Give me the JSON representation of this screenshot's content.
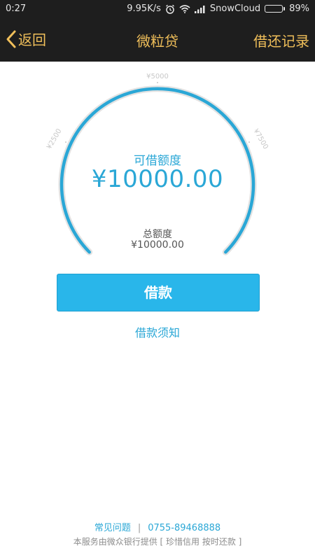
{
  "status_bar": {
    "time": "0:27",
    "speed": "9.95K/s",
    "carrier": "SnowCloud",
    "battery": "89%",
    "battery_level": 0.89,
    "icons": [
      "alarm-icon",
      "wifi-icon",
      "signal-icon",
      "battery-icon"
    ]
  },
  "nav": {
    "back_label": "返回",
    "title": "微粒贷",
    "records_label": "借还记录",
    "accent_color": "#f0bf5a"
  },
  "gauge": {
    "tick_labels": [
      "¥2500",
      "¥5000",
      "¥7500"
    ],
    "available_label": "可借额度",
    "available_amount": "¥10000.00",
    "total_label": "总额度",
    "total_amount": "¥10000.00",
    "fill_fraction": 1.0,
    "accent_color": "#2aa7d6"
  },
  "actions": {
    "borrow_label": "借款",
    "notice_label": "借款须知"
  },
  "footer": {
    "faq_label": "常见问题",
    "separator": "|",
    "phone": "0755-89468888",
    "note": "本服务由微众银行提供 [ 珍惜信用 按时还款 ]"
  }
}
